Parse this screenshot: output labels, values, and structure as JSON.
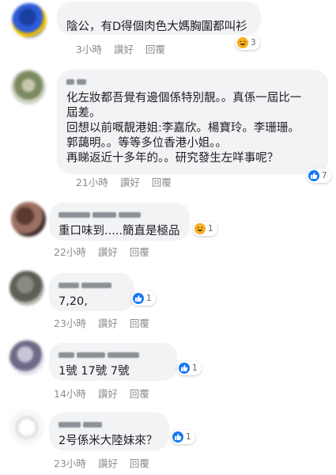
{
  "actions": {
    "like_label": "讚好",
    "reply_label": "回覆"
  },
  "comments": [
    {
      "text": "陰公，有D得個肉色大媽胸圍都叫衫",
      "time": "3小時",
      "reaction_icon": "haha-icon",
      "reaction_color": "#f7b125",
      "reaction_count": "3"
    },
    {
      "text": "化左妝都吾覺有邊個係特別靚。。真係一屆比一\n屆差。\n回想以前嘅靚港姐:李嘉欣。楊寶玲。李珊珊。\n郭藹明。。等等多位香港小姐。。\n再睇返近十多年的。。研究發生左咩事呢？",
      "time": "21小時",
      "reaction_icon": "like-icon",
      "reaction_color": "#1877f2",
      "reaction_count": "7"
    },
    {
      "text": "重口味到.....簡直是極品",
      "time": "22小時",
      "reaction_icon": "haha-icon",
      "reaction_color": "#f7b125",
      "reaction_count": "1"
    },
    {
      "text": "7,20,",
      "time": "23小時",
      "reaction_icon": "like-icon",
      "reaction_color": "#1877f2",
      "reaction_count": "1"
    },
    {
      "text": "1號 17號 7號",
      "time": "14小時",
      "reaction_icon": "like-icon",
      "reaction_color": "#1877f2",
      "reaction_count": "1"
    },
    {
      "text": "2号係米大陸妹來？",
      "time": "23小時",
      "reaction_icon": "like-icon",
      "reaction_color": "#1877f2",
      "reaction_count": "1"
    }
  ]
}
